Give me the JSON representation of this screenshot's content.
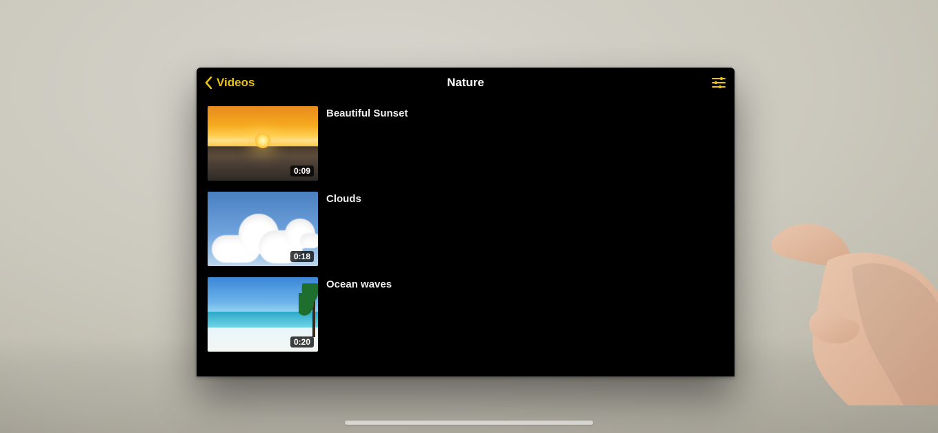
{
  "accent": "#e7c31b",
  "nav": {
    "back_label": "Videos",
    "title": "Nature"
  },
  "videos": [
    {
      "title": "Beautiful Sunset",
      "duration": "0:09",
      "thumb": "sunset"
    },
    {
      "title": "Clouds",
      "duration": "0:18",
      "thumb": "clouds"
    },
    {
      "title": "Ocean waves",
      "duration": "0:20",
      "thumb": "ocean"
    }
  ]
}
